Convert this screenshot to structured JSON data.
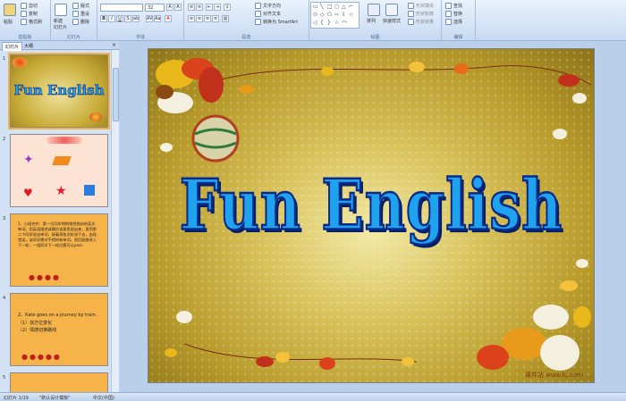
{
  "ribbon": {
    "clipboard": {
      "paste": "粘贴",
      "cut": "剪切",
      "copy": "复制",
      "format_painter": "格式刷",
      "label": "剪贴板"
    },
    "slides": {
      "new_slide": "新建",
      "new_slide2": "幻灯片",
      "layout": "版式",
      "reset": "重设",
      "delete": "删除",
      "label": "幻灯片"
    },
    "font": {
      "font_size": "32",
      "label": "字体"
    },
    "paragraph": {
      "text_direction": "文字方向",
      "align_text": "对齐文本",
      "smartart": "转换为 SmartArt",
      "label": "段落"
    },
    "drawing": {
      "arrange": "排列",
      "quick_styles": "快速样式",
      "shape_fill": "形状填充",
      "shape_outline": "形状轮廓",
      "shape_effects": "形状效果",
      "label": "绘图"
    },
    "editing": {
      "find": "查找",
      "replace": "替换",
      "select": "选择",
      "label": "编辑"
    }
  },
  "pane": {
    "tabs": [
      "幻灯片",
      "大纲"
    ],
    "thumbs": [
      {
        "num": "1",
        "title": "Fun English"
      },
      {
        "num": "2"
      },
      {
        "num": "3",
        "text": "1、小组合作：第一位同学悄悄地把指向的英文单词，用英语描述或模仿该意思说出来，直到第二个同学说出单词，接着再依次轮流下去，出现错误，该同学需对不错的新单词，然后能够进入下一轮，一组同学下一轮比赛可以pass"
      },
      {
        "num": "4",
        "text_en": "2、Kate goes on a journey by train.",
        "line1": "（1）找方位变化",
        "line2": "（2）情感切换路线"
      },
      {
        "num": "5"
      }
    ]
  },
  "slide": {
    "title": "Fun English",
    "footer": "课件站 www.kj.com"
  },
  "status": {
    "slide_info": "幻灯片 1/19",
    "theme": "\"默认设计模板\"",
    "language": "中文(中国)"
  }
}
